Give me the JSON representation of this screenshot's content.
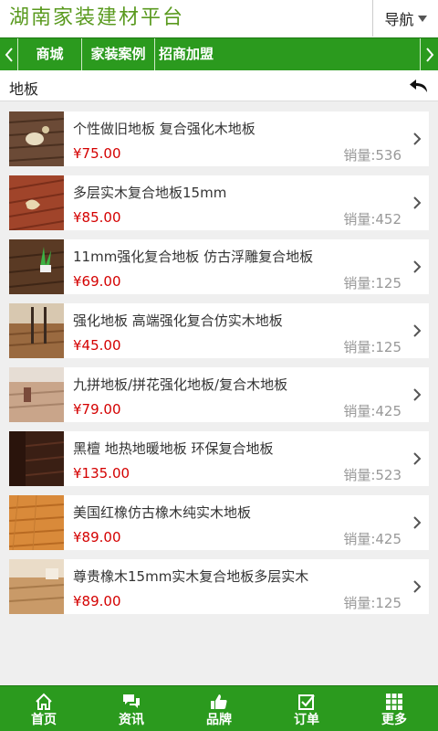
{
  "header": {
    "logo": "湖南家装建材平台",
    "nav_label": "导航"
  },
  "menu": {
    "items": [
      {
        "label": "商城"
      },
      {
        "label": "家装案例"
      },
      {
        "label": "招商加盟"
      }
    ]
  },
  "breadcrumb": {
    "title": "地板"
  },
  "products": [
    {
      "name": "个性做旧地板 复合强化木地板",
      "price": "¥75.00",
      "sales": "销量:536",
      "thumb_color": "#6b4a36"
    },
    {
      "name": "多层实木复合地板15mm",
      "price": "¥85.00",
      "sales": "销量:452",
      "thumb_color": "#a0442a"
    },
    {
      "name": "11mm强化复合地板 仿古浮雕复合地板",
      "price": "¥69.00",
      "sales": "销量:125",
      "thumb_color": "#5a3a24"
    },
    {
      "name": "强化地板 高端强化复合仿实木地板",
      "price": "¥45.00",
      "sales": "销量:125",
      "thumb_color": "#9a6a40"
    },
    {
      "name": "九拼地板/拼花强化地板/复合木地板",
      "price": "¥79.00",
      "sales": "销量:425",
      "thumb_color": "#c9a58a"
    },
    {
      "name": "黑檀 地热地暖地板 环保复合地板",
      "price": "¥135.00",
      "sales": "销量:523",
      "thumb_color": "#3a1f14"
    },
    {
      "name": "美国红橡仿古橡木纯实木地板",
      "price": "¥89.00",
      "sales": "销量:425",
      "thumb_color": "#d98a3a"
    },
    {
      "name": "尊贵橡木15mm实木复合地板多层实木",
      "price": "¥89.00",
      "sales": "销量:125",
      "thumb_color": "#c99a68"
    }
  ],
  "bottom_nav": {
    "items": [
      {
        "label": "首页",
        "icon": "home-icon"
      },
      {
        "label": "资讯",
        "icon": "chat-icon"
      },
      {
        "label": "品牌",
        "icon": "thumbs-up-icon"
      },
      {
        "label": "订单",
        "icon": "checkbox-icon"
      },
      {
        "label": "更多",
        "icon": "grid-icon"
      }
    ]
  },
  "colors": {
    "brand_green": "#2b9a1e",
    "logo_green": "#5a9a1f",
    "price_red": "#d40000",
    "sales_gray": "#999999"
  }
}
